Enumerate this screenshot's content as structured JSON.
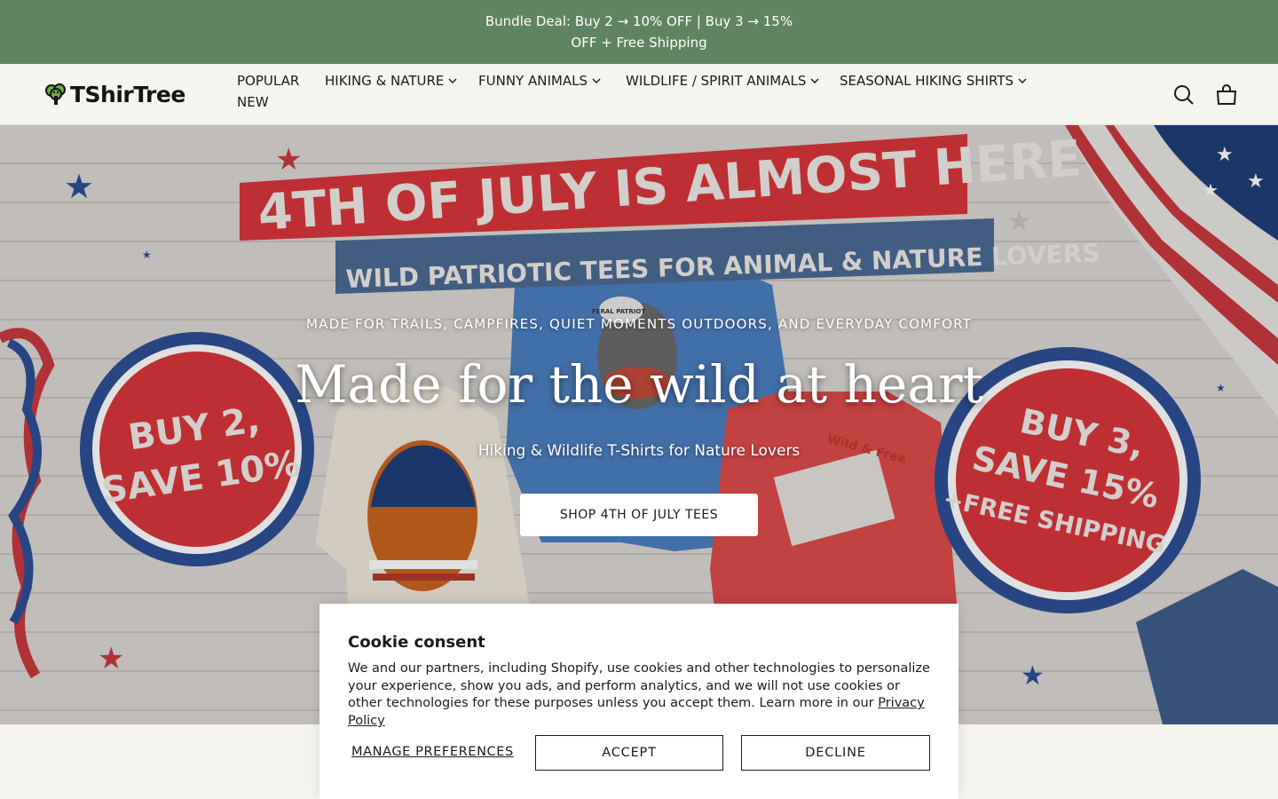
{
  "announcement": {
    "text": "Bundle Deal: Buy 2 → 10% OFF | Buy 3 → 15% OFF + Free Shipping"
  },
  "header": {
    "logo_text": "TShirTree",
    "nav": [
      {
        "label": "POPULAR",
        "has_dropdown": false
      },
      {
        "label": "HIKING & NATURE",
        "has_dropdown": true
      },
      {
        "label": "FUNNY ANIMALS",
        "has_dropdown": true
      },
      {
        "label": "WILDLIFE / SPIRIT ANIMALS",
        "has_dropdown": true
      },
      {
        "label": "SEASONAL HIKING SHIRTS",
        "has_dropdown": true
      },
      {
        "label": "NEW",
        "has_dropdown": false
      }
    ],
    "icons": {
      "search": "search-icon",
      "cart": "cart-icon"
    }
  },
  "hero": {
    "banner_line1": "4TH OF JULY IS ALMOST HERE",
    "banner_line2": "WILD PATRIOTIC TEES FOR ANIMAL & NATURE LOVERS",
    "badge_left": [
      "BUY 2,",
      "SAVE 10%"
    ],
    "badge_right": [
      "BUY 3,",
      "SAVE 15%",
      "+FREE SHIPPING"
    ],
    "tee_text": "Wild & Free",
    "cap_text": "FERAL PATRIOT",
    "eyebrow": "MADE FOR TRAILS, CAMPFIRES, QUIET MOMENTS OUTDOORS, AND EVERYDAY COMFORT",
    "title": "Made for the wild at heart",
    "subtitle": "Hiking & Wildlife T-Shirts for Nature Lovers",
    "cta": "SHOP 4TH OF JULY TEES"
  },
  "cookie": {
    "title": "Cookie consent",
    "body": "We and our partners, including Shopify, use cookies and other technologies to personalize your experience, show you ads, and perform analytics, and we will not use cookies or other technologies for these purposes unless you accept them. Learn more in our",
    "link": "Privacy Policy",
    "manage": "MANAGE PREFERENCES",
    "accept": "ACCEPT",
    "decline": "DECLINE"
  },
  "colors": {
    "announcement_bg": "#5e8560",
    "header_bg": "#f5f4ef",
    "banner_red": "#d9363b",
    "banner_blue": "#4a6b94",
    "badge_blue": "#2d4f95"
  }
}
